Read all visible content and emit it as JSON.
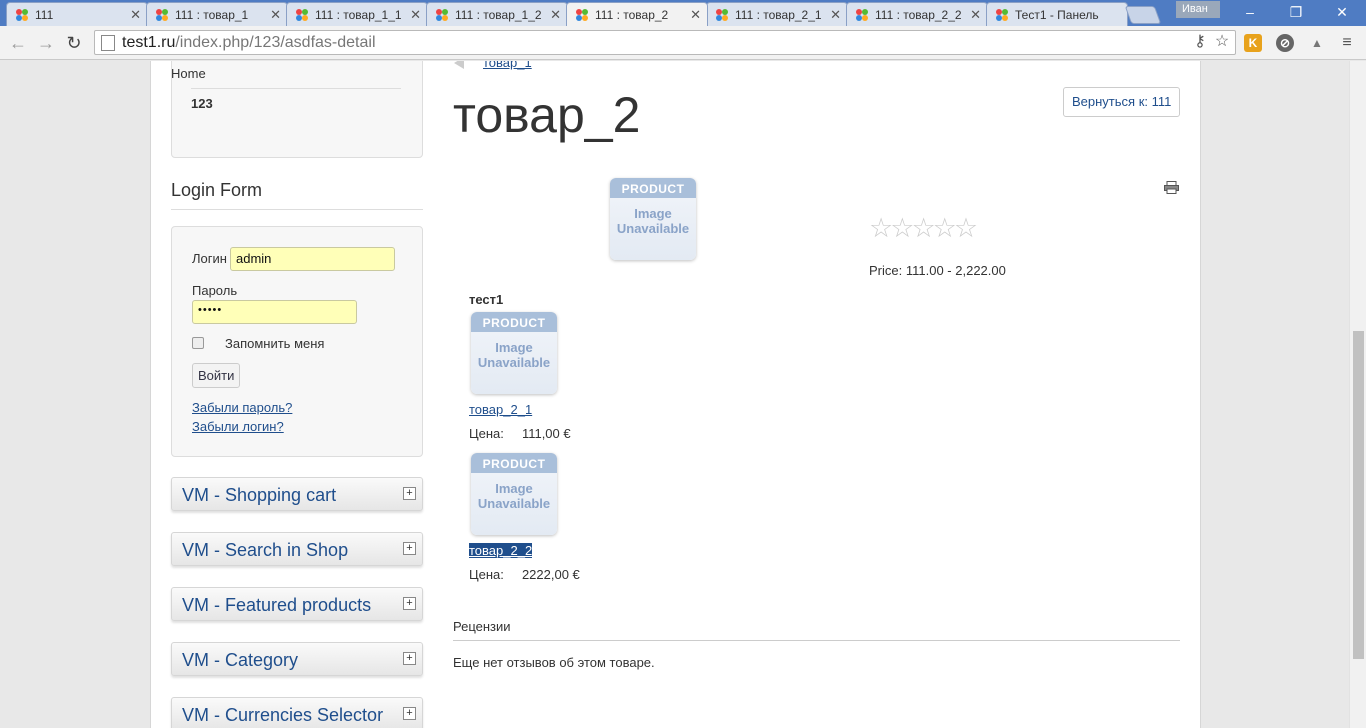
{
  "browser": {
    "tabs": [
      {
        "title": "111",
        "active": false
      },
      {
        "title": "111 : товар_1",
        "active": false
      },
      {
        "title": "111 : товар_1_1",
        "active": false
      },
      {
        "title": "111 : товар_1_2",
        "active": false
      },
      {
        "title": "111 : товар_2",
        "active": true
      },
      {
        "title": "111 : товар_2_1",
        "active": false
      },
      {
        "title": "111 : товар_2_2",
        "active": false
      },
      {
        "title": "Тест1 - Панель",
        "active": false
      }
    ],
    "user_name": "Иван",
    "url_host": "test1.ru",
    "url_path": "/index.php/123/asdfas-detail",
    "extension_k_label": "K",
    "colors": {
      "tab_strip": "#4f7cc3",
      "accent_link": "#1f4e8c"
    }
  },
  "sidebar": {
    "menu": [
      {
        "label": "Home"
      },
      {
        "label": "123"
      }
    ],
    "login": {
      "title": "Login Form",
      "username_label": "Логин",
      "username_value": "admin",
      "password_label": "Пароль",
      "password_value": "•••••",
      "remember_label": "Запомнить меня",
      "submit_label": "Войти",
      "forgot_password": "Забыли пароль?",
      "forgot_login": "Забыли логин?"
    },
    "modules": [
      {
        "title": "VM - Shopping cart"
      },
      {
        "title": "VM - Search in Shop"
      },
      {
        "title": "VM - Featured products"
      },
      {
        "title": "VM - Category"
      },
      {
        "title": "VM - Currencies Selector"
      }
    ]
  },
  "main": {
    "breadcrumb_prev": "товар_1",
    "title": "товар_2",
    "back_button": "Вернуться к: 111",
    "image_placeholder": {
      "top": "PRODUCT",
      "line1": "Image",
      "line2": "Unavailable"
    },
    "rating_stars": 5,
    "rating_value": 0,
    "price_label": "Price:",
    "price_value": "111.00 - 2,222.00",
    "category_title": "тест1",
    "children": [
      {
        "name": "товар_2_1",
        "price_label": "Цена:",
        "price": "111,00 €",
        "selected": false
      },
      {
        "name": "товар_2_2",
        "price_label": "Цена:",
        "price": "2222,00 €",
        "selected": true
      }
    ],
    "reviews_title": "Рецензии",
    "reviews_empty": "Еще нет отзывов об этом товаре."
  }
}
